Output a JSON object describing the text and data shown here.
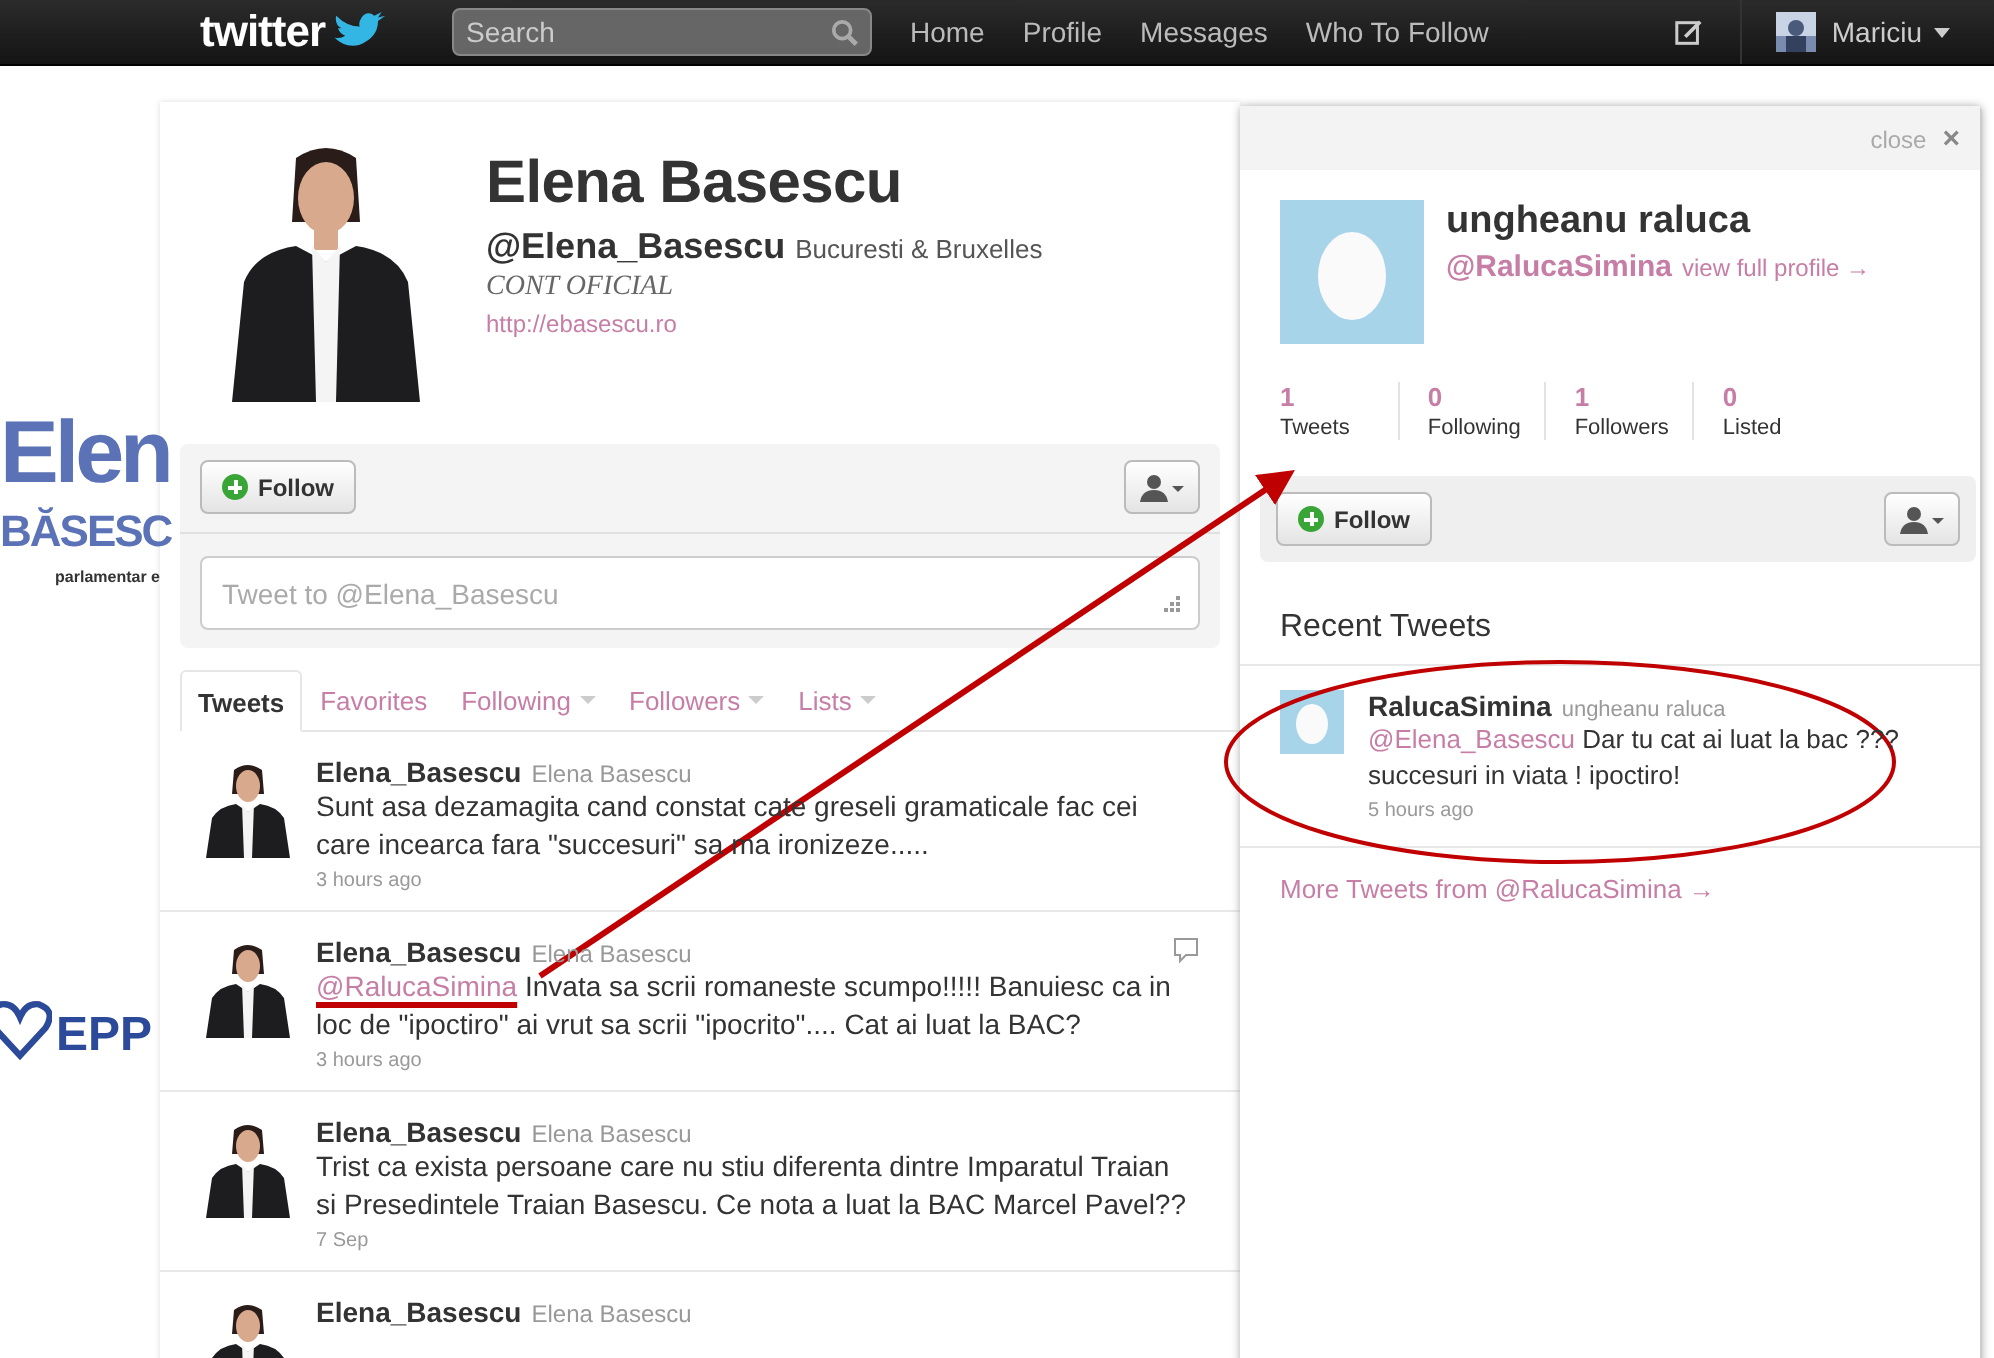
{
  "topbar": {
    "logo": "twitter",
    "search": {
      "placeholder": "Search"
    },
    "nav": [
      "Home",
      "Profile",
      "Messages",
      "Who To Follow"
    ],
    "user": "Mariciu"
  },
  "background": {
    "logo_lines": [
      "Elen",
      "BĂSESC",
      "parlamentar e"
    ],
    "party": "EPP"
  },
  "profile": {
    "name": "Elena Basescu",
    "handle": "@Elena_Basescu",
    "location": "Bucuresti & Bruxelles",
    "bio": "CONT OFICIAL",
    "url": "http://ebasescu.ro",
    "follow": "Follow",
    "tweet_box": {
      "placeholder": "Tweet to @Elena_Basescu"
    }
  },
  "tabs": [
    {
      "label": "Tweets",
      "selected": true,
      "dropdown": false
    },
    {
      "label": "Favorites",
      "selected": false,
      "dropdown": false
    },
    {
      "label": "Following",
      "selected": false,
      "dropdown": true
    },
    {
      "label": "Followers",
      "selected": false,
      "dropdown": true
    },
    {
      "label": "Lists",
      "selected": false,
      "dropdown": true
    }
  ],
  "tweets": [
    {
      "author": "Elena_Basescu",
      "name": "Elena Basescu",
      "text": "Sunt asa dezamagita cand constat cate greseli gramaticale fac cei care incearca fara \"succesuri\" sa ma ironizeze.....",
      "time": "3 hours ago",
      "hovered": false
    },
    {
      "author": "Elena_Basescu",
      "name": "Elena Basescu",
      "mention": "@RalucaSimina",
      "text": "Invata sa scrii romaneste scumpo!!!!! Banuiesc ca in loc de \"ipoctiro\" ai vrut sa scrii \"ipocrito\".... Cat ai luat la BAC?",
      "time": "3 hours ago",
      "hovered": true
    },
    {
      "author": "Elena_Basescu",
      "name": "Elena Basescu",
      "text": "Trist ca exista persoane care nu stiu diferenta dintre Imparatul Traian si Presedintele Traian Basescu. Ce nota a luat la BAC Marcel Pavel??",
      "time": "7 Sep",
      "hovered": false
    },
    {
      "author": "Elena_Basescu",
      "name": "Elena Basescu",
      "hovered": false
    }
  ],
  "panel": {
    "close": "close",
    "close_icon": "×",
    "name": "ungheanu raluca",
    "handle": "@RalucaSimina",
    "view_profile": "view full profile →",
    "stats": [
      {
        "count": "1",
        "label": "Tweets"
      },
      {
        "count": "0",
        "label": "Following"
      },
      {
        "count": "1",
        "label": "Followers"
      },
      {
        "count": "0",
        "label": "Listed"
      }
    ],
    "follow": "Follow",
    "recent_title": "Recent Tweets",
    "tweet": {
      "author": "RalucaSimina",
      "name": "ungheanu raluca",
      "mention": "@Elena_Basescu",
      "text": "Dar tu cat ai luat la bac ??? succesuri in viata ! ipoctiro!",
      "time": "5 hours ago"
    },
    "more": "More Tweets from @RalucaSimina →"
  }
}
